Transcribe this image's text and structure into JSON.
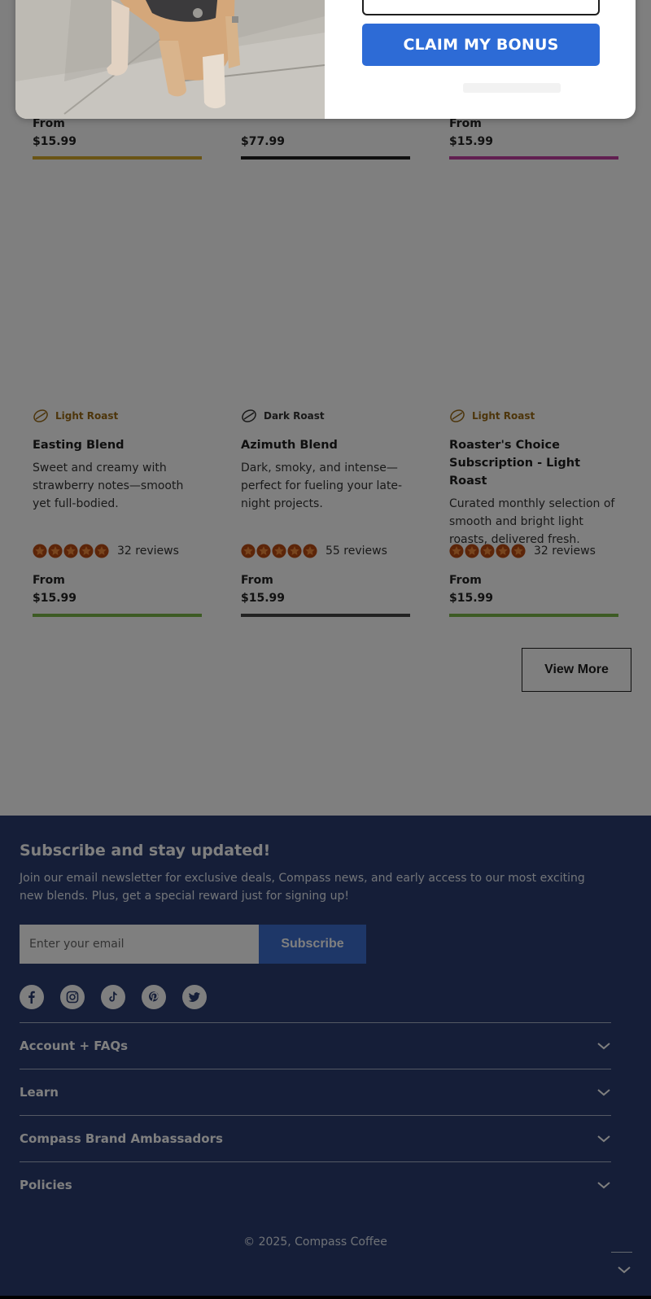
{
  "top_row": [
    {
      "price_prefix": "From",
      "price": "$15.99",
      "accent": "#d4a92b"
    },
    {
      "price_prefix": "",
      "price": "$77.99",
      "accent": "#1e1e1e"
    },
    {
      "price_prefix": "From",
      "price": "$15.99",
      "accent": "#c23fa2"
    }
  ],
  "products": [
    {
      "roast": "Light Roast",
      "roast_icon": "coffee-bean-icon",
      "title": "Easting Blend",
      "description": "Sweet and creamy with strawberry notes—smooth yet full-bodied.",
      "rating": 5,
      "reviews": "32 reviews",
      "price_prefix": "From",
      "price": "$15.99",
      "accent": "#7ab648"
    },
    {
      "roast": "Dark Roast",
      "roast_icon": "coffee-bean-icon",
      "title": "Azimuth Blend",
      "description": "Dark, smoky, and intense—perfect for fueling your late-night projects.",
      "rating": 5,
      "reviews": "55 reviews",
      "price_prefix": "From",
      "price": "$15.99",
      "accent": "#444444"
    },
    {
      "roast": "Light Roast",
      "roast_icon": "coffee-bean-icon",
      "title": "Roaster's Choice Subscription - Light Roast",
      "description": "Curated monthly selection of smooth and bright light roasts, delivered fresh.",
      "rating": 5,
      "reviews": "32 reviews",
      "price_prefix": "From",
      "price": "$15.99",
      "accent": "#7ab648"
    }
  ],
  "view_more_label": "View More",
  "modal": {
    "claim_label": "CLAIM MY BONUS",
    "accent": "#2d6bd6"
  },
  "footer": {
    "title": "Subscribe and stay updated!",
    "description": "Join our email newsletter for exclusive deals, Compass news, and early access to our most exciting new blends. Plus, get a special reward just for signing up!",
    "email_placeholder": "Enter your email",
    "subscribe_label": "Subscribe",
    "socials": [
      "facebook-icon",
      "instagram-icon",
      "tiktok-icon",
      "pinterest-icon",
      "twitter-icon"
    ],
    "accordions": [
      "Account + FAQs",
      "Learn",
      "Compass Brand Ambassadors",
      "Policies"
    ],
    "copyright": "© 2025, Compass Coffee",
    "background": "#2a3d70"
  }
}
